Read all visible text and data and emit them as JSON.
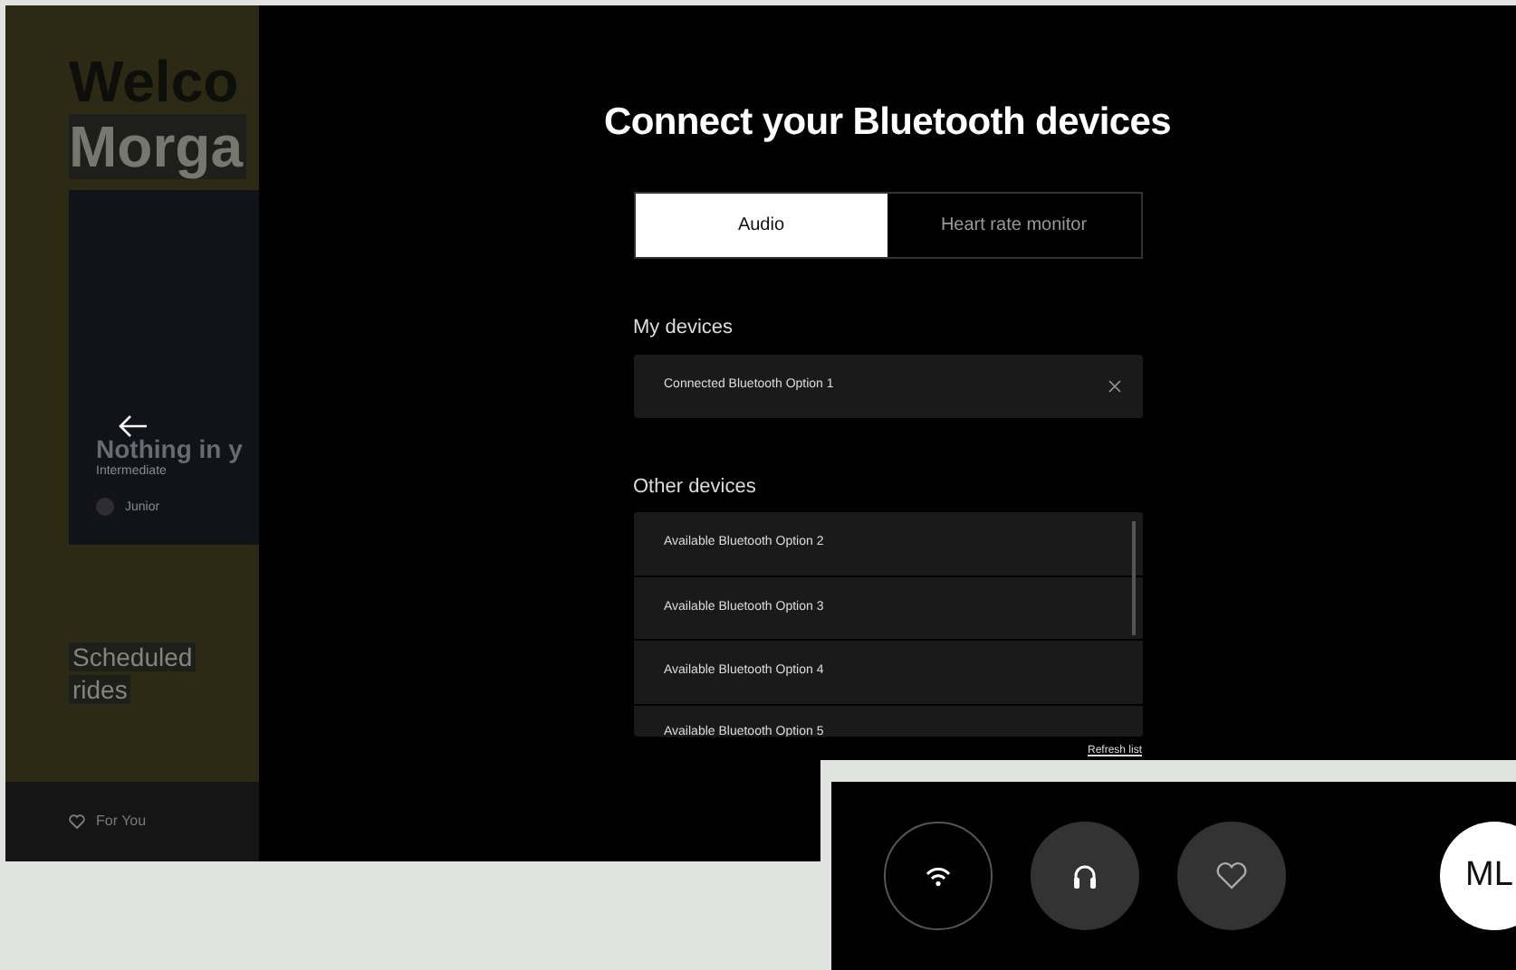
{
  "background_screen": {
    "greeting": [
      "Welco",
      "Morga"
    ],
    "card": {
      "title": "Nothing in y",
      "level_label": "Intermediate",
      "instructor": "Junior"
    },
    "section": [
      "Scheduled",
      "rides"
    ],
    "nav_item": "For You"
  },
  "dialog": {
    "title": "Connect your Bluetooth devices",
    "tabs": [
      {
        "label": "Audio",
        "selected": true
      },
      {
        "label": "Heart rate monitor",
        "selected": false
      }
    ],
    "my_devices": {
      "heading": "My devices",
      "items": [
        {
          "label": "Connected Bluetooth Option 1"
        }
      ]
    },
    "other_devices": {
      "heading": "Other devices",
      "items": [
        {
          "label": "Available Bluetooth Option 2"
        },
        {
          "label": "Available Bluetooth Option 3"
        },
        {
          "label": "Available Bluetooth Option 4"
        },
        {
          "label": "Available Bluetooth Option 5"
        }
      ]
    },
    "refresh_link": "Refresh list"
  },
  "bottom_bar": {
    "buttons": [
      {
        "kind": "wifi",
        "filled": false
      },
      {
        "kind": "headphones",
        "filled": true
      },
      {
        "kind": "heart",
        "filled": true
      }
    ],
    "avatar": "ML"
  }
}
